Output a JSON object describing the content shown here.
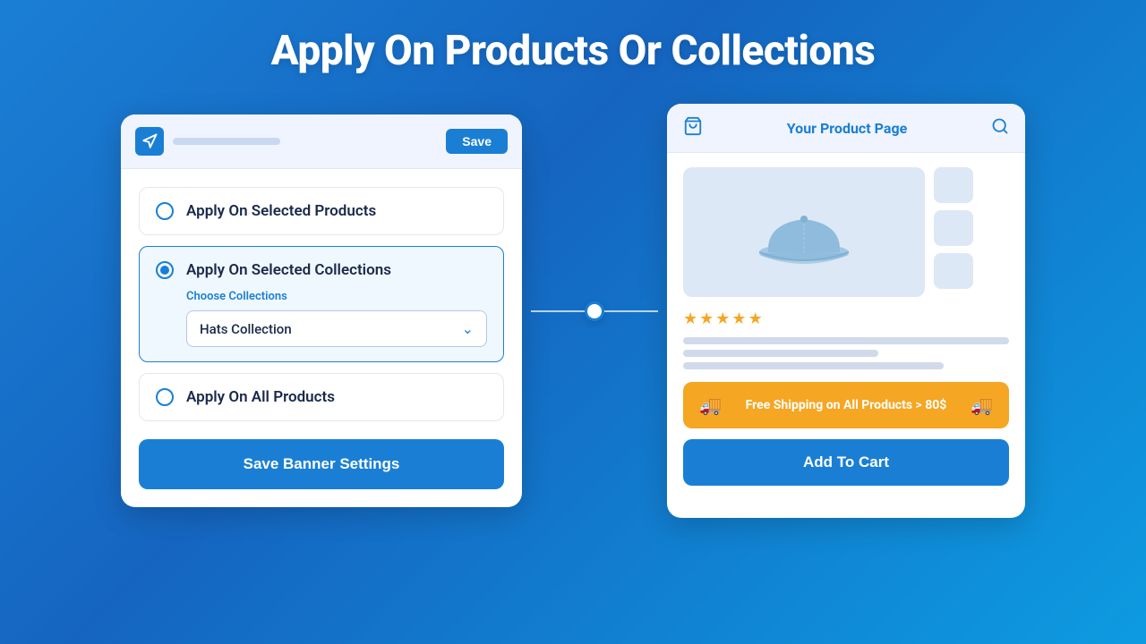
{
  "page": {
    "title": "Apply On Products Or Collections"
  },
  "left_card": {
    "save_button": "Save",
    "options": [
      {
        "id": "selected-products",
        "label": "Apply On Selected Products",
        "selected": false
      },
      {
        "id": "selected-collections",
        "label": "Apply On Selected Collections",
        "selected": true,
        "choose_label": "Choose Collections",
        "collection_value": "Hats Collection"
      },
      {
        "id": "all-products",
        "label": "Apply On All Products",
        "selected": false
      }
    ],
    "save_banner_btn": "Save Banner Settings"
  },
  "right_card": {
    "header_title": "Your Product Page",
    "shipping_banner_text": "Free Shipping on All Products > 80$",
    "add_to_cart_btn": "Add To Cart"
  },
  "icons": {
    "megaphone": "📣",
    "cart": "🛒",
    "search": "🔍",
    "truck": "🚚",
    "chevron_down": "⌄"
  }
}
